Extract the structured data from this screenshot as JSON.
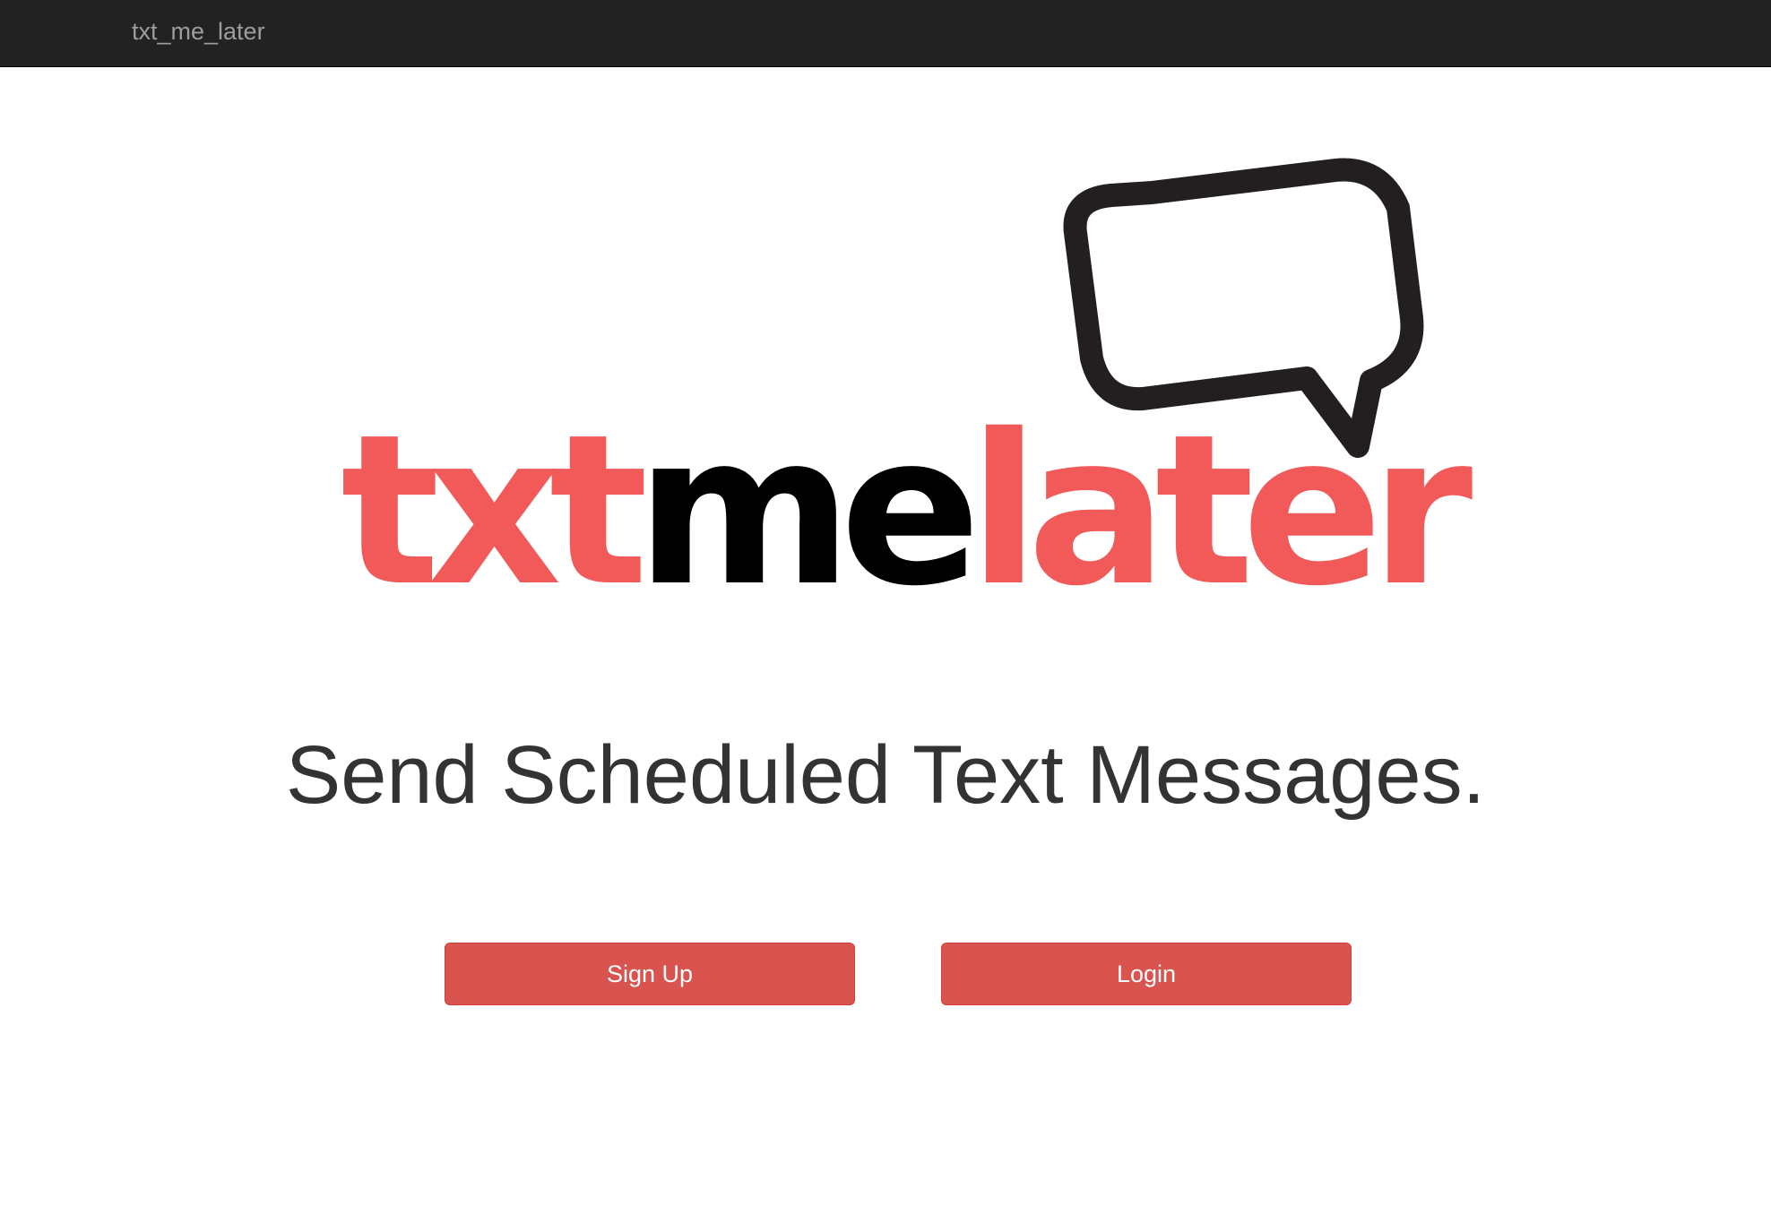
{
  "navbar": {
    "brand": "txt_me_later"
  },
  "logo": {
    "part1": "txt",
    "part2": "me",
    "part3": "later",
    "accent_color": "#f25a5a",
    "dark_color": "#000000",
    "icon": "speech-bubble-icon"
  },
  "hero": {
    "tagline": "Send Scheduled Text Messages."
  },
  "actions": {
    "signup_label": "Sign Up",
    "login_label": "Login",
    "button_color": "#d9534f"
  }
}
